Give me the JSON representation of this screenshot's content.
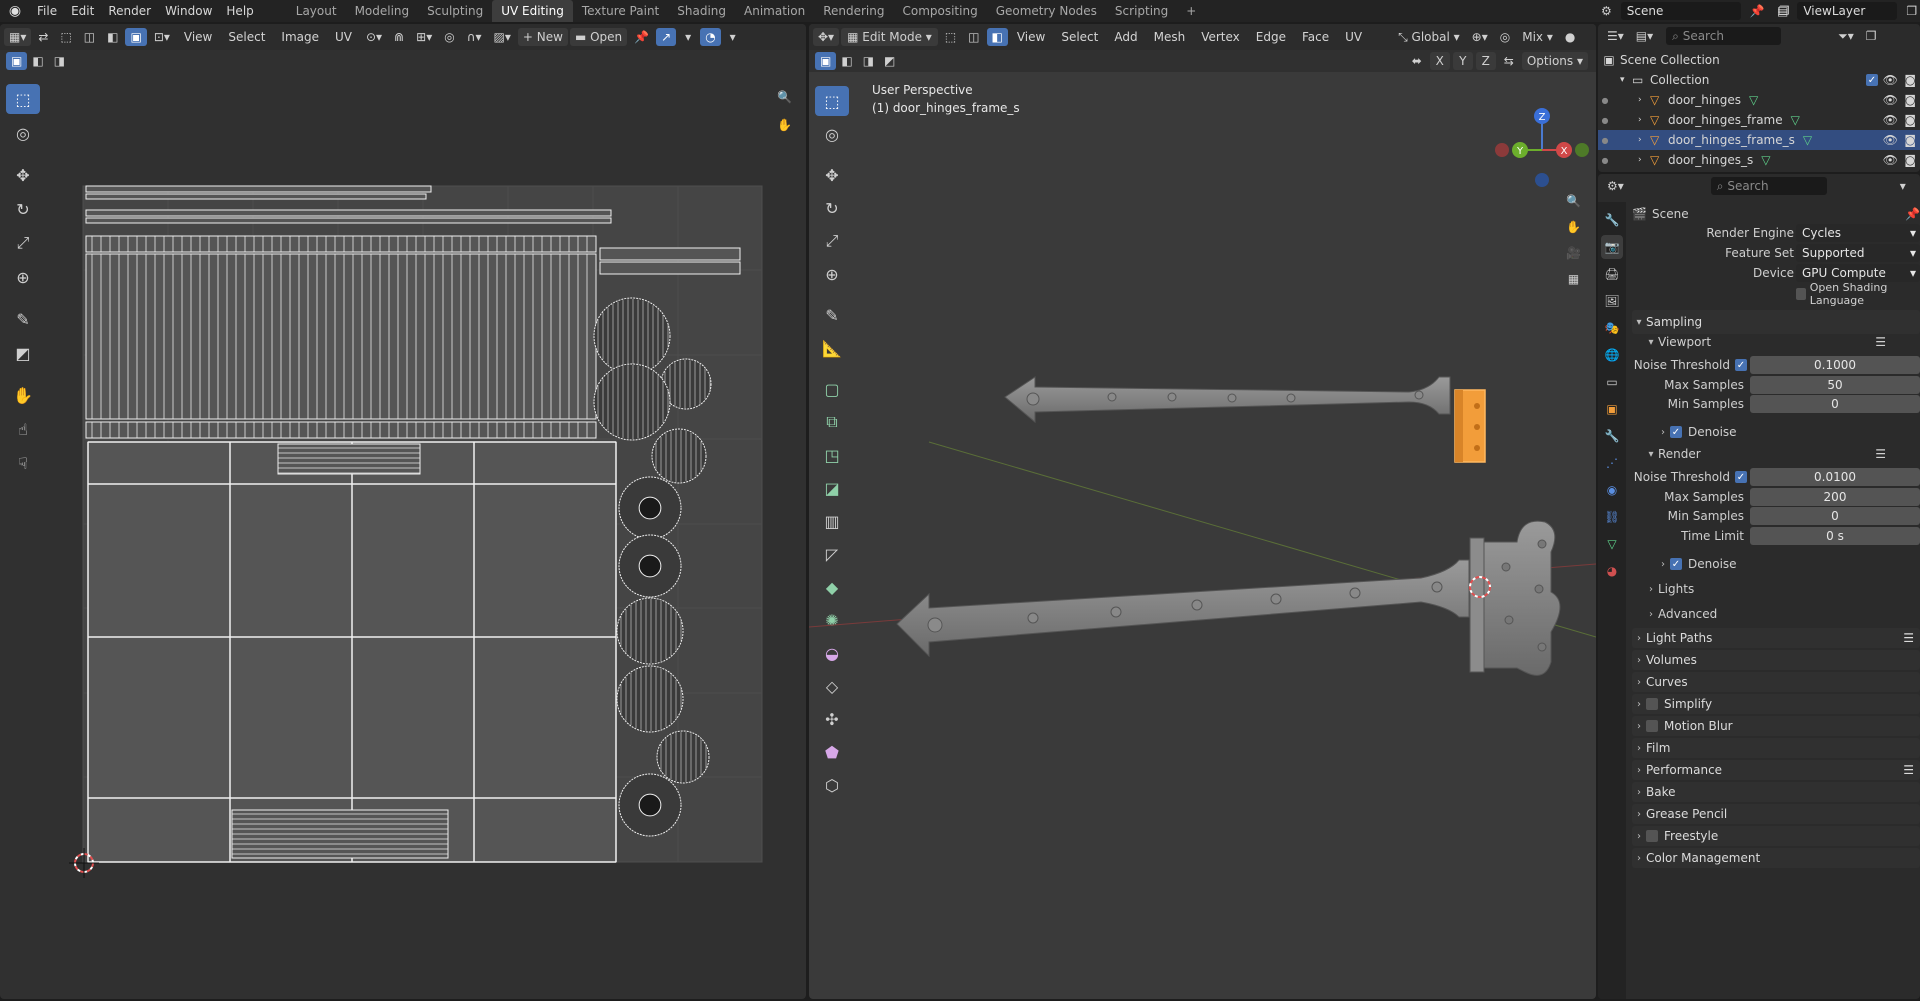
{
  "topbar": {
    "menus": [
      "File",
      "Edit",
      "Render",
      "Window",
      "Help"
    ],
    "workspaces": [
      "Layout",
      "Modeling",
      "Sculpting",
      "UV Editing",
      "Texture Paint",
      "Shading",
      "Animation",
      "Rendering",
      "Compositing",
      "Geometry Nodes",
      "Scripting"
    ],
    "active_workspace": "UV Editing",
    "add_tab": "+",
    "scene": "Scene",
    "view_layer": "ViewLayer"
  },
  "uv_editor": {
    "menus": [
      "View",
      "Select",
      "Image",
      "UV"
    ],
    "new_label": "New",
    "open_label": "Open"
  },
  "viewport": {
    "mode": "Edit Mode",
    "menus": [
      "View",
      "Select",
      "Add",
      "Mesh",
      "Vertex",
      "Edge",
      "Face",
      "UV"
    ],
    "transform_orientation": "Global",
    "pivot_label": "Mix",
    "axes": [
      "X",
      "Y",
      "Z"
    ],
    "options_label": "Options",
    "overlay_line1": "User Perspective",
    "overlay_line2": "(1) door_hinges_frame_s",
    "gizmo_z": "Z",
    "gizmo_y": "Y",
    "gizmo_x": "X"
  },
  "outliner": {
    "search_placeholder": "Search",
    "scene_collection": "Scene Collection",
    "collection": "Collection",
    "objects": [
      {
        "name": "door_hinges",
        "selected": false
      },
      {
        "name": "door_hinges_frame",
        "selected": false
      },
      {
        "name": "door_hinges_frame_s",
        "selected": true
      },
      {
        "name": "door_hinges_s",
        "selected": false
      }
    ]
  },
  "properties": {
    "search_placeholder": "Search",
    "context": "Scene",
    "render_engine_label": "Render Engine",
    "render_engine": "Cycles",
    "feature_set_label": "Feature Set",
    "feature_set": "Supported",
    "device_label": "Device",
    "device": "GPU Compute",
    "osl_label": "Open Shading Language",
    "sampling": "Sampling",
    "viewport": "Viewport",
    "noise_threshold_label": "Noise Threshold",
    "viewport_noise_threshold": "0.1000",
    "max_samples_label": "Max Samples",
    "viewport_max_samples": "50",
    "min_samples_label": "Min Samples",
    "viewport_min_samples": "0",
    "denoise_label": "Denoise",
    "render": "Render",
    "render_noise_threshold": "0.0100",
    "render_max_samples": "200",
    "render_min_samples": "0",
    "time_limit_label": "Time Limit",
    "render_time_limit": "0 s",
    "lights": "Lights",
    "advanced": "Advanced",
    "panels": [
      "Light Paths",
      "Volumes",
      "Curves",
      "Simplify",
      "Motion Blur",
      "Film",
      "Performance",
      "Bake",
      "Grease Pencil",
      "Freestyle",
      "Color Management"
    ]
  }
}
